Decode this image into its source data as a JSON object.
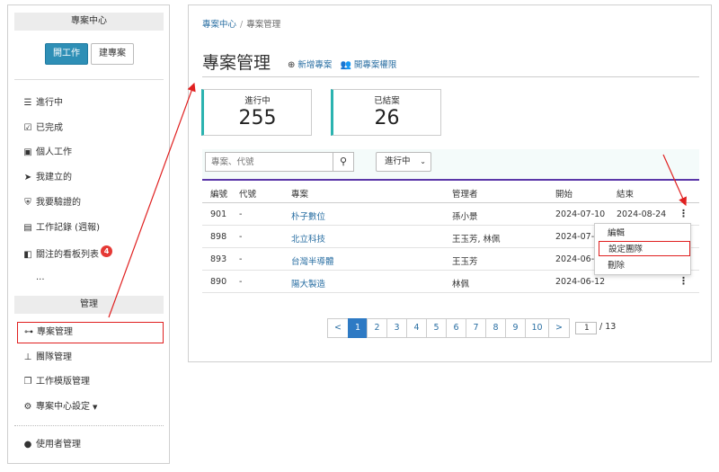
{
  "sidebar": {
    "header_project": "專案中心",
    "btn_open": "開工作",
    "btn_create": "建專案",
    "items": [
      {
        "label": "進行中",
        "icon": "list-check-icon"
      },
      {
        "label": "已完成",
        "icon": "checkbox-icon"
      },
      {
        "label": "個人工作",
        "icon": "briefcase-icon"
      },
      {
        "label": "我建立的",
        "icon": "pointer-icon"
      },
      {
        "label": "我要驗證的",
        "icon": "shield-check-icon"
      },
      {
        "label": "工作記錄 (週報)",
        "icon": "document-icon"
      },
      {
        "label": "關注的看板列表",
        "icon": "board-icon",
        "badge": "4"
      },
      {
        "label": "..."
      }
    ],
    "header_admin": "管理",
    "admin_items": [
      {
        "label": "專案管理",
        "icon": "project-tree-icon"
      },
      {
        "label": "團隊管理",
        "icon": "org-chart-icon"
      },
      {
        "label": "工作模版管理",
        "icon": "copy-template-icon"
      },
      {
        "label": "專案中心設定",
        "icon": "gear-icon"
      }
    ],
    "user_admin": {
      "label": "使用者管理",
      "icon": "user-icon"
    }
  },
  "breadcrumb": {
    "root": "專案中心",
    "sep": "/",
    "current": "專案管理"
  },
  "title": "專案管理",
  "actions": {
    "new_project": "新增專案",
    "open_permission": "開專案權限"
  },
  "stats": [
    {
      "label": "進行中",
      "value": "255"
    },
    {
      "label": "已結案",
      "value": "26"
    }
  ],
  "search": {
    "placeholder": "專案、代號",
    "icon": "search-icon"
  },
  "status_filter": {
    "selected": "進行中"
  },
  "table": {
    "headers": [
      "編號",
      "代號",
      "專案",
      "管理者",
      "開始",
      "結束"
    ],
    "rows": [
      {
        "id": "901",
        "code": "-",
        "project": "朴子數位",
        "manager": "孫小景",
        "start": "2024-07-10",
        "end": "2024-08-24"
      },
      {
        "id": "898",
        "code": "-",
        "project": "北立科技",
        "manager": "王玉芳, 林佩",
        "start": "2024-07-0",
        "end": ""
      },
      {
        "id": "893",
        "code": "-",
        "project": "台灣半導體",
        "manager": "王玉芳",
        "start": "2024-06-1",
        "end": ""
      },
      {
        "id": "890",
        "code": "-",
        "project": "陽大製造",
        "manager": "林佩",
        "start": "2024-06-12",
        "end": ""
      }
    ]
  },
  "row_menu": {
    "edit": "編輯",
    "set_team": "設定團隊",
    "delete": "刪除"
  },
  "pagination": {
    "prev": "<",
    "pages": [
      "1",
      "2",
      "3",
      "4",
      "5",
      "6",
      "7",
      "8",
      "9",
      "10"
    ],
    "next": ">",
    "current": "1",
    "input_value": "1",
    "total": "/ 13"
  },
  "colors": {
    "accent": "#2e8fb6",
    "teal": "#2bb3b0",
    "purple": "#5a36a8",
    "annotation_red": "#e02020",
    "link": "#2a6fa3"
  }
}
